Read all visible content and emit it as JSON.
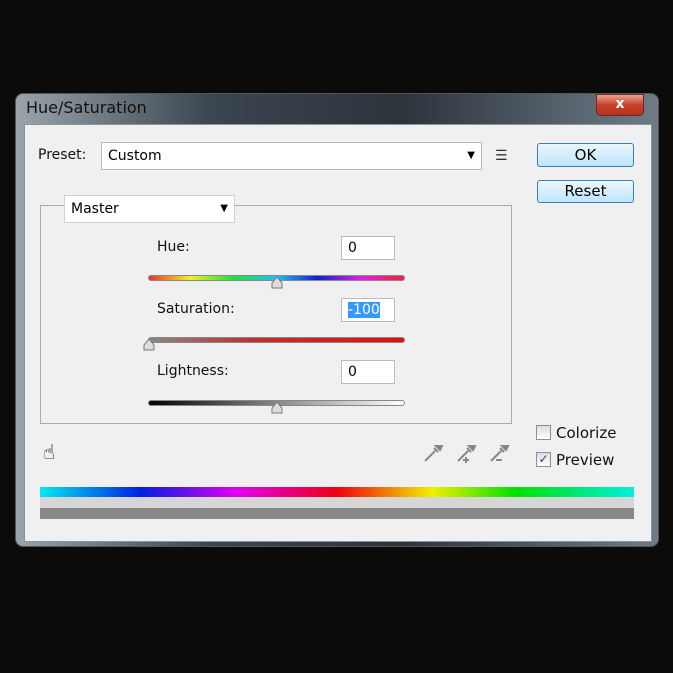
{
  "window": {
    "title": "Hue/Saturation",
    "close_label": "x"
  },
  "preset": {
    "label": "Preset:",
    "value": "Custom"
  },
  "buttons": {
    "ok": "OK",
    "reset": "Reset"
  },
  "channel": {
    "value": "Master"
  },
  "hue": {
    "label": "Hue:",
    "value": "0",
    "slider_value": 0,
    "min": -180,
    "max": 180
  },
  "saturation": {
    "label": "Saturation:",
    "value": "-100",
    "slider_value": -100,
    "min": -100,
    "max": 100
  },
  "lightness": {
    "label": "Lightness:",
    "value": "0",
    "slider_value": 0,
    "min": -100,
    "max": 100
  },
  "options": {
    "colorize": {
      "label": "Colorize",
      "checked": false
    },
    "preview": {
      "label": "Preview",
      "checked": true
    }
  },
  "colors": {
    "selection": "#3399ff",
    "button_border": "#3c7fb1"
  },
  "icons": [
    "hand-adjust-icon",
    "eyedropper-icon",
    "eyedropper-plus-icon",
    "eyedropper-minus-icon",
    "preset-menu-icon"
  ]
}
